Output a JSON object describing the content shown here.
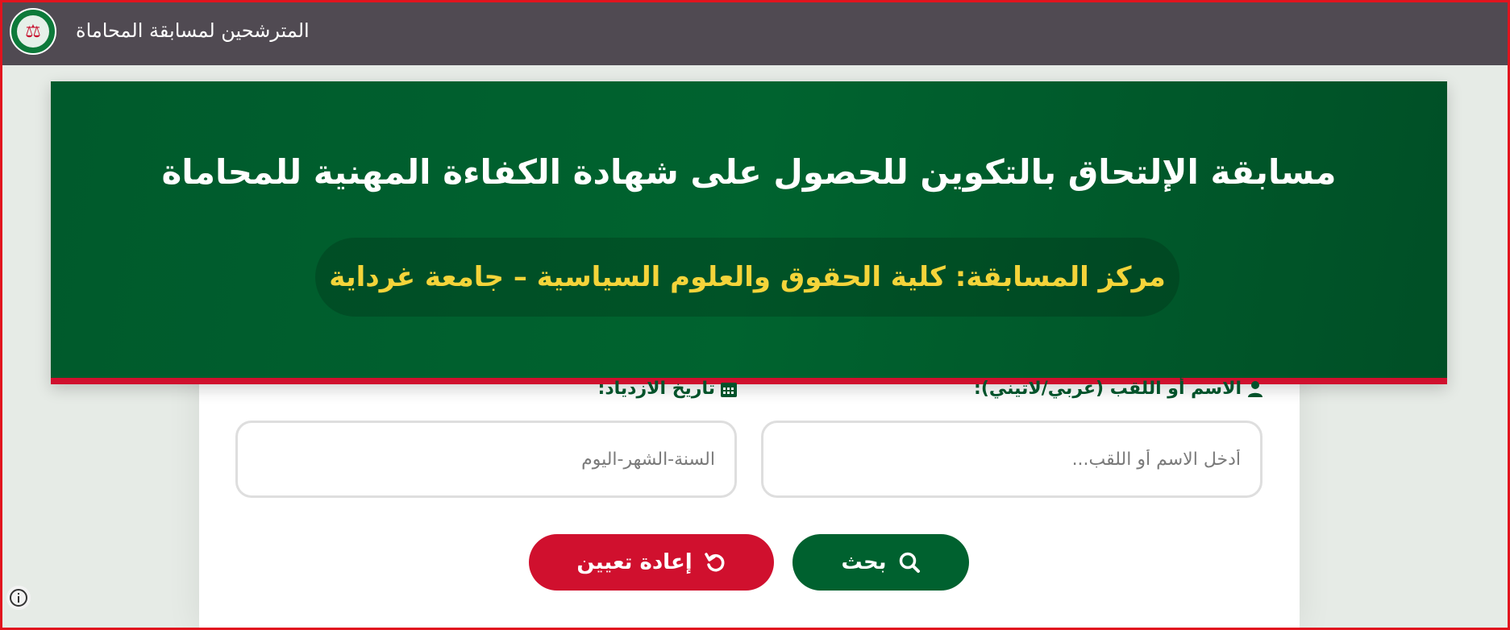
{
  "topbar": {
    "title": "المترشحين لمسابقة المحاماة",
    "logo_icon": "bar-association-logo-icon"
  },
  "hero": {
    "title": "مسابقة الإلتحاق بالتكوين للحصول على شهادة الكفاءة المهنية للمحاماة",
    "subtitle": "مركز المسابقة: كلية الحقوق والعلوم السياسية – جامعة غرداية"
  },
  "form": {
    "name_label": "الاسم أو اللقب (عربي/لاتيني):",
    "name_placeholder": "أدخل الاسم أو اللقب...",
    "dob_label": "تاريخ الازدياد:",
    "dob_placeholder": "السنة-الشهر-اليوم"
  },
  "buttons": {
    "search_label": "بحث",
    "reset_label": "إعادة تعيين"
  },
  "colors": {
    "green": "#00612f",
    "red": "#d0102e",
    "gold": "#f4d43a",
    "topbar": "#504a52"
  }
}
